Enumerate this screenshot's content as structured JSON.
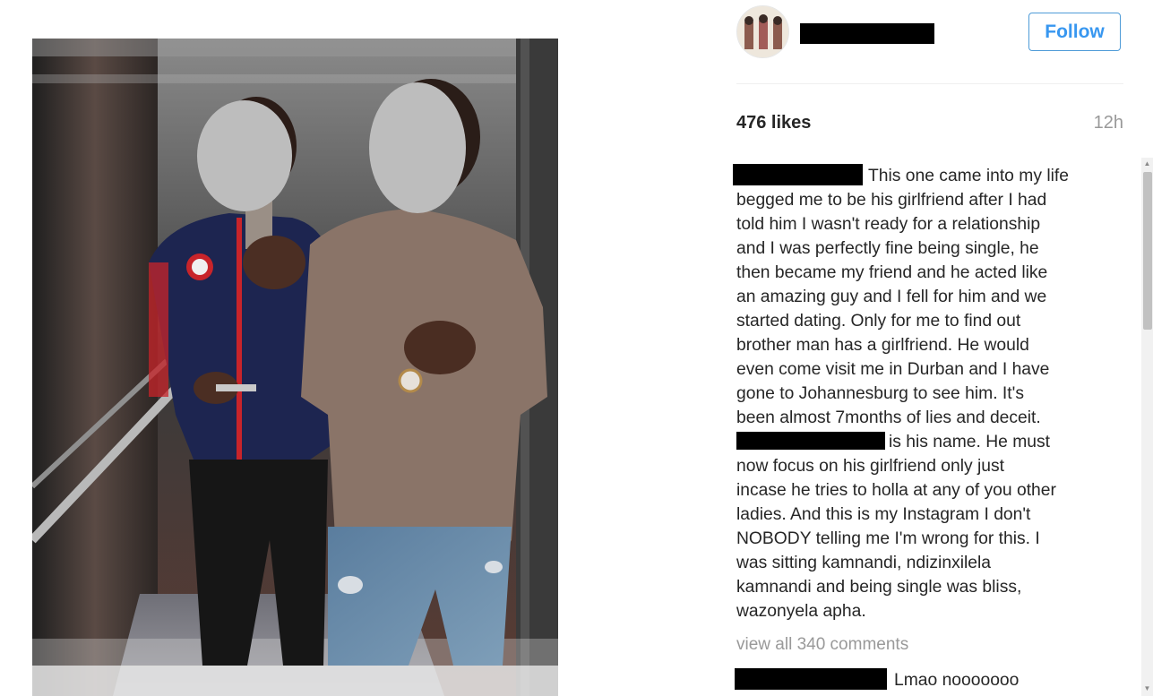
{
  "post": {
    "follow_label": "Follow",
    "likes": "476 likes",
    "time_ago": "12h",
    "caption": {
      "line_1": "This one came into my life",
      "line_2": "begged me to be his girlfriend after I had",
      "line_3": "told him I wasn't ready for a relationship",
      "line_4": "and I was perfectly fine being single, he",
      "line_5": "then became my friend and he acted like",
      "line_6": "an amazing guy and I fell for him and we",
      "line_7": "started dating. Only for me to find out",
      "line_8": "brother man has a girlfriend. He would",
      "line_9": "even come visit me in Durban and I have",
      "line_10": "gone to Johannesburg to see him. It's",
      "line_11": "been almost 7months of lies and deceit.",
      "line_12": "is his name. He must",
      "line_13": "now focus on his girlfriend only just",
      "line_14": "incase he tries to holla at any of you other",
      "line_15": "ladies. And this is my Instagram I don't",
      "line_16": "NOBODY telling me I'm wrong for this. I",
      "line_17": "was sitting kamnandi, ndizinxilela",
      "line_18": "kamnandi and being single was bliss,",
      "line_19": "wazonyela apha."
    },
    "view_all_comments": "view all 340 comments",
    "first_comment": "Lmao nooooooo"
  },
  "colors": {
    "follow_blue": "#3897f0",
    "muted_gray": "#999999",
    "redaction": "#000000"
  }
}
